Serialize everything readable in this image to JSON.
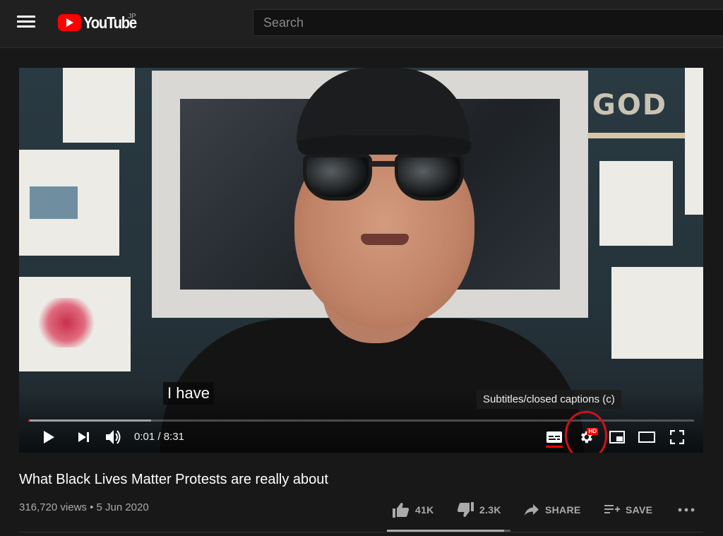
{
  "header": {
    "logo_text": "YouTube",
    "country_code": "JP",
    "search": {
      "placeholder": "Search"
    }
  },
  "player": {
    "caption_text": "I have",
    "tooltip": "Subtitles/closed captions (c)",
    "time": "0:01 / 8:31",
    "progress_played_fraction": 0.002,
    "progress_loaded_fraction": 0.185,
    "hd_badge": "HD",
    "colors": {
      "accent": "#ff0000",
      "annotation": "#d0101a"
    }
  },
  "video": {
    "title": "What Black Lives Matter Protests are really about",
    "views_date": "316,720 views • 5 Jun 2020",
    "likes": "41K",
    "dislikes": "2.3K",
    "share_label": "SHARE",
    "save_label": "SAVE",
    "like_ratio": 0.947
  }
}
